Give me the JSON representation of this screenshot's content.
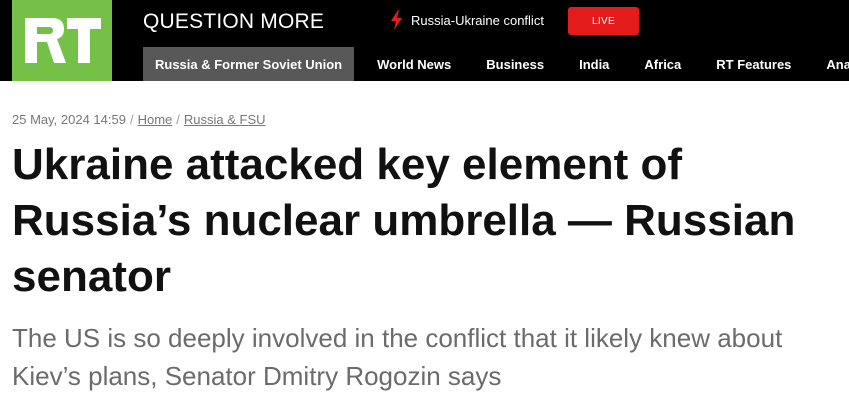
{
  "header": {
    "logo_text": "RT",
    "tagline": "QUESTION MORE",
    "hot_topic": "Russia-Ukraine conflict",
    "live_label": "LIVE",
    "brand_green": "#75c046",
    "live_red": "#e41b1b"
  },
  "nav": {
    "items": [
      {
        "label": "Russia & Former Soviet Union",
        "active": true
      },
      {
        "label": "World News"
      },
      {
        "label": "Business"
      },
      {
        "label": "India"
      },
      {
        "label": "Africa"
      },
      {
        "label": "RT Features"
      },
      {
        "label": "Analysis"
      }
    ]
  },
  "article": {
    "date": "25 May, 2024 14:59",
    "breadcrumb": [
      {
        "label": "Home"
      },
      {
        "label": "Russia & FSU"
      }
    ],
    "title": "Ukraine attacked key element of Russia’s nuclear umbrella — Russian senator",
    "summary": "The US is so deeply involved in the conflict that it likely knew about Kiev’s plans, Senator Dmitry Rogozin says"
  }
}
